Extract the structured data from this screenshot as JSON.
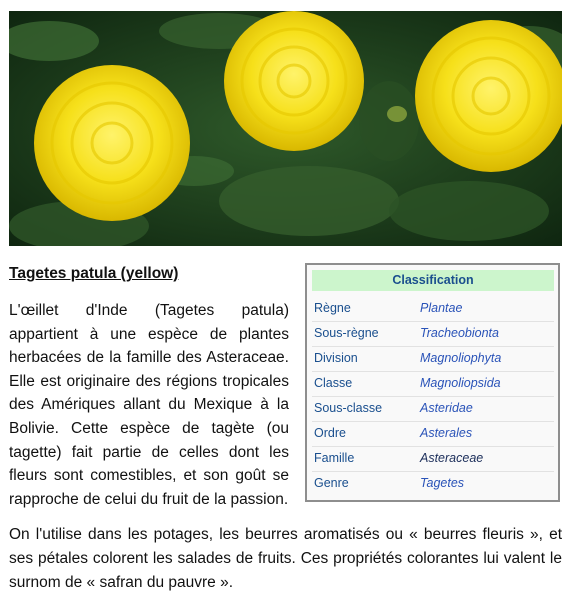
{
  "article": {
    "title": "Tagetes patula (yellow)",
    "paragraph1": "L'œillet d'Inde (Tagetes patula) appartient à une espèce de plantes herbacées de la famille des Asteraceae. Elle est originaire des régions tropicales des Amériques allant du Mexique à la Bolivie. Cette espèce de tagète (ou tagette) fait partie de celles dont les fleurs sont comestibles, et son goût se rapproche de celui du fruit de la passion.",
    "paragraph2": "On l'utilise dans les potages, les beurres aromatisés ou « beurres fleuris », et ses pétales colorent les salades de fruits. Ces propriétés colorantes lui valent le surnom de « safran du pauvre »."
  },
  "classification": {
    "header": "Classification",
    "rows": [
      {
        "rank": "Règne",
        "taxon": "Plantae"
      },
      {
        "rank": "Sous-règne",
        "taxon": "Tracheobionta"
      },
      {
        "rank": "Division",
        "taxon": "Magnoliophyta"
      },
      {
        "rank": "Classe",
        "taxon": "Magnoliopsida"
      },
      {
        "rank": "Sous-classe",
        "taxon": "Asteridae"
      },
      {
        "rank": "Ordre",
        "taxon": "Asterales"
      },
      {
        "rank": "Famille",
        "taxon": "Asteraceae"
      },
      {
        "rank": "Genre",
        "taxon": "Tagetes"
      }
    ]
  },
  "colors": {
    "header_bg": "#ccf5cc",
    "link_blue": "#2a53b8",
    "flower_yellow": "#f4e21a",
    "foliage_green": "#1f3d1a"
  }
}
